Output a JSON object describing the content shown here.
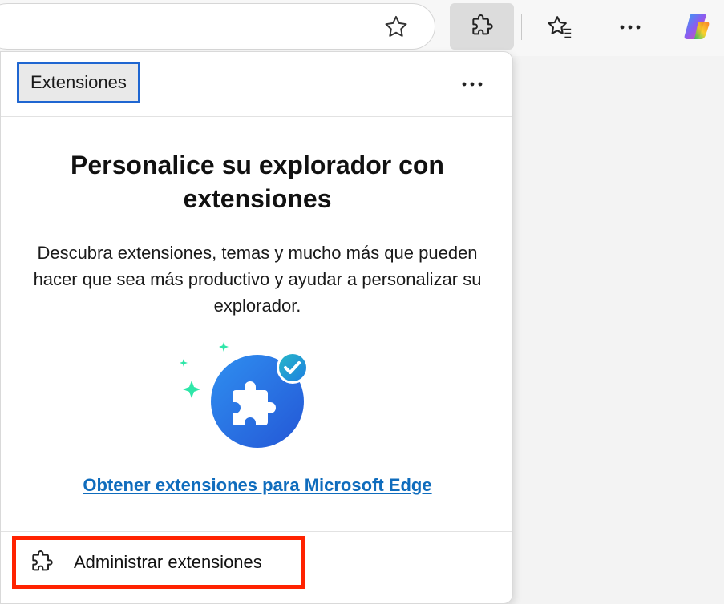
{
  "toolbar": {
    "icons": [
      "star-icon",
      "puzzle-icon",
      "favorites-icon",
      "more-icon",
      "copilot-icon"
    ]
  },
  "panel": {
    "title": "Extensiones",
    "headline": "Personalice su explorador con extensiones",
    "description": "Descubra extensiones, temas y mucho más que pueden hacer que sea más productivo y ayudar a personalizar su explorador.",
    "get_link": "Obtener extensiones para Microsoft Edge",
    "manage_label": "Administrar extensiones"
  },
  "colors": {
    "accent_blue": "#1f66d1",
    "link_blue": "#0f6cbd",
    "highlight_red": "#ff2200",
    "sparkle_green": "#2ee6a8"
  }
}
